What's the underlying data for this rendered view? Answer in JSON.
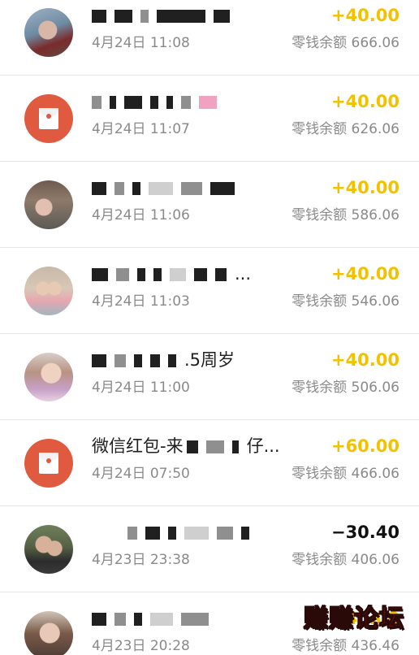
{
  "transactions": [
    {
      "avatar": "photo-avatar",
      "title_text": "",
      "time": "4月24日 11:08",
      "amount": "+40.00",
      "balance": "零钱余额 666.06"
    },
    {
      "avatar": "red-packet-icon",
      "title_text": "",
      "time": "4月24日 11:07",
      "amount": "+40.00",
      "balance": "零钱余额 626.06"
    },
    {
      "avatar": "photo-avatar",
      "title_text": "",
      "time": "4月24日 11:06",
      "amount": "+40.00",
      "balance": "零钱余额 586.06"
    },
    {
      "avatar": "photo-avatar",
      "title_text": "...",
      "time": "4月24日 11:03",
      "amount": "+40.00",
      "balance": "零钱余额 546.06"
    },
    {
      "avatar": "photo-avatar",
      "title_text": ".5周岁",
      "time": "4月24日 11:00",
      "amount": "+40.00",
      "balance": "零钱余额 506.06"
    },
    {
      "avatar": "red-packet-icon",
      "title_prefix": "微信红包-来",
      "title_suffix": "仔...",
      "time": "4月24日 07:50",
      "amount": "+60.00",
      "balance": "零钱余额 466.06"
    },
    {
      "avatar": "photo-avatar",
      "title_text": "",
      "time": "4月23日 23:38",
      "amount": "−30.40",
      "balance": "零钱余额 406.06"
    },
    {
      "avatar": "photo-avatar",
      "title_text": "",
      "time": "4月23日 20:28",
      "amount": "+40.00",
      "balance": "零钱余额 436.46"
    }
  ],
  "watermark": {
    "text_a": "赚赚",
    "text_b": "论坛"
  },
  "colors": {
    "positive_amount": "#f2c200",
    "negative_amount": "#111111",
    "red_packet": "#e05a3f",
    "secondary_text": "#8a8a8a"
  }
}
